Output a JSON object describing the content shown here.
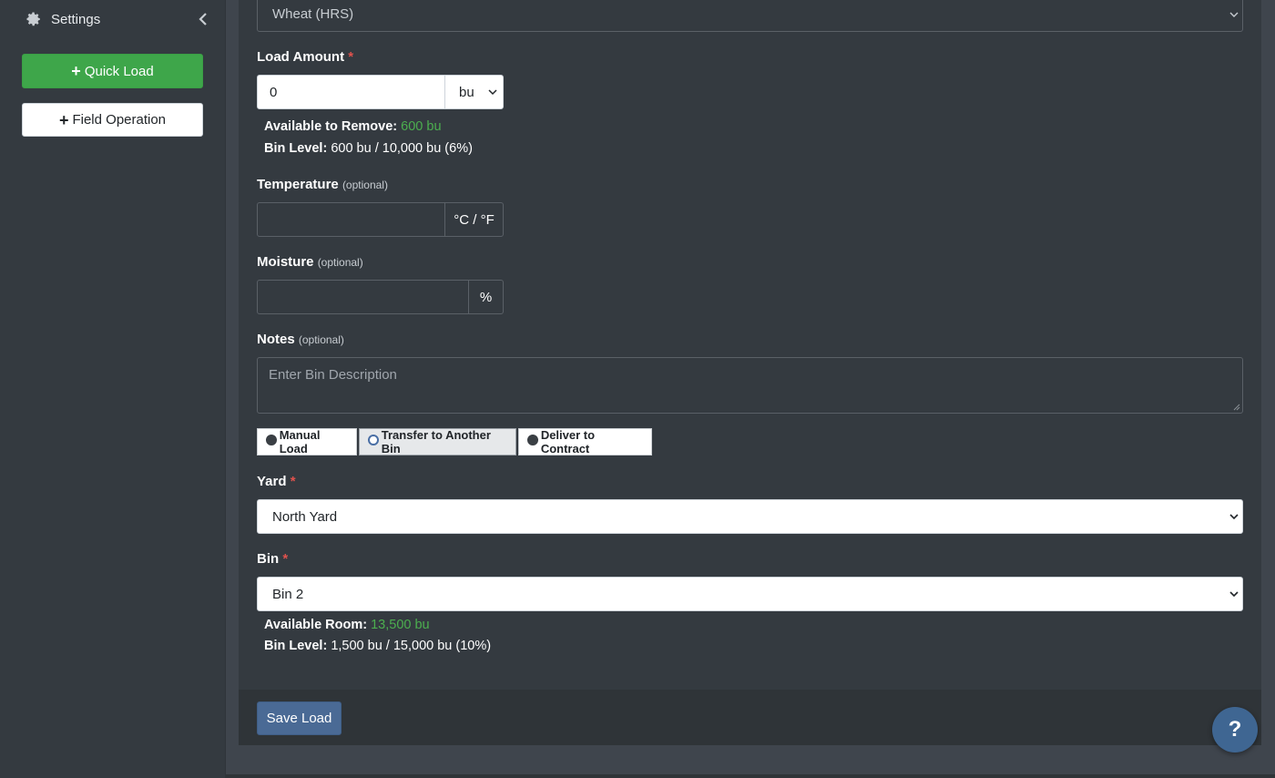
{
  "sidebar": {
    "settings_label": "Settings",
    "quick_load_label": "Quick Load",
    "field_operation_label": "Field Operation"
  },
  "form": {
    "commodity": {
      "value": "Wheat (HRS)"
    },
    "load_amount": {
      "label": "Load Amount",
      "required_mark": "*",
      "value": "0",
      "unit": "bu",
      "available_label": "Available to Remove:",
      "available_value": "600 bu",
      "bin_level_label": "Bin Level:",
      "bin_level_value": "600 bu / 10,000 bu (6%)"
    },
    "temperature": {
      "label": "Temperature",
      "optional": "(optional)",
      "value": "",
      "unit": "°C / °F"
    },
    "moisture": {
      "label": "Moisture",
      "optional": "(optional)",
      "value": "",
      "unit": "%"
    },
    "notes": {
      "label": "Notes",
      "optional": "(optional)",
      "placeholder": "Enter Bin Description"
    },
    "load_type": {
      "options": [
        "Manual Load",
        "Transfer to Another Bin",
        "Deliver to Contract"
      ],
      "selected": "Transfer to Another Bin"
    },
    "yard": {
      "label": "Yard",
      "required_mark": "*",
      "value": "North Yard"
    },
    "bin": {
      "label": "Bin",
      "required_mark": "*",
      "value": "Bin 2",
      "available_label": "Available Room:",
      "available_value": "13,500 bu",
      "bin_level_label": "Bin Level:",
      "bin_level_value": "1,500 bu / 15,000 bu (10%)"
    },
    "save_label": "Save Load"
  },
  "help": {
    "label": "?"
  },
  "colors": {
    "accent_green": "#4cae4f",
    "required_red": "#e0524d",
    "save_blue": "#4a6a95",
    "quick_load_green": "#3ea64a"
  }
}
